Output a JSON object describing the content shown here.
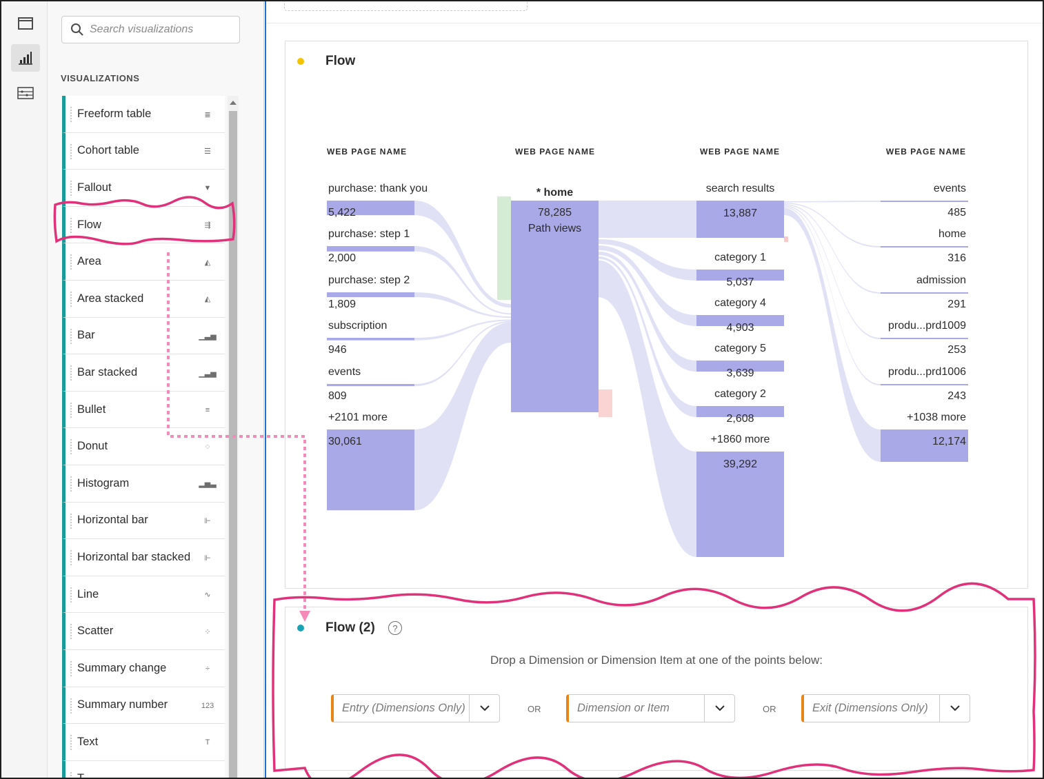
{
  "rail": {
    "items": [
      {
        "name": "panels-icon"
      },
      {
        "name": "visualizations-icon"
      },
      {
        "name": "components-icon"
      }
    ]
  },
  "sidebar": {
    "search_placeholder": "Search visualizations",
    "heading": "VISUALIZATIONS",
    "items": [
      {
        "label": "Freeform table",
        "icon": "≣"
      },
      {
        "label": "Cohort table",
        "icon": "☰"
      },
      {
        "label": "Fallout",
        "icon": "▼"
      },
      {
        "label": "Flow",
        "icon": "⇶"
      },
      {
        "label": "Area",
        "icon": "◭"
      },
      {
        "label": "Area stacked",
        "icon": "◭"
      },
      {
        "label": "Bar",
        "icon": "▁▃▅"
      },
      {
        "label": "Bar stacked",
        "icon": "▁▃▅"
      },
      {
        "label": "Bullet",
        "icon": "≡"
      },
      {
        "label": "Donut",
        "icon": "◌"
      },
      {
        "label": "Histogram",
        "icon": "▂▅▃"
      },
      {
        "label": "Horizontal bar",
        "icon": "⊩"
      },
      {
        "label": "Horizontal bar stacked",
        "icon": "⊩"
      },
      {
        "label": "Line",
        "icon": "∿"
      },
      {
        "label": "Scatter",
        "icon": "⁘"
      },
      {
        "label": "Summary change",
        "icon": "÷"
      },
      {
        "label": "Summary number",
        "icon": "123"
      },
      {
        "label": "Text",
        "icon": "T"
      },
      {
        "label": "T",
        "icon": ""
      }
    ]
  },
  "flow_panel": {
    "title": "Flow",
    "dot_color": "#f5c400",
    "column_header": "WEB PAGE NAME",
    "left_nodes": [
      {
        "label": "purchase: thank you",
        "value": "5,422",
        "size": 5422
      },
      {
        "label": "purchase: step 1",
        "value": "2,000",
        "size": 2000
      },
      {
        "label": "purchase: step 2",
        "value": "1,809",
        "size": 1809
      },
      {
        "label": "subscription",
        "value": "946",
        "size": 946
      },
      {
        "label": "events",
        "value": "809",
        "size": 809
      },
      {
        "label": "+2101 more",
        "value": "30,061",
        "size": 30061
      }
    ],
    "center_node": {
      "label": "* home",
      "value": "78,285",
      "sub": "Path views",
      "size": 78285
    },
    "right_nodes": [
      {
        "label": "search results",
        "value": "13,887",
        "size": 13887
      },
      {
        "label": "category 1",
        "value": "5,037",
        "size": 5037
      },
      {
        "label": "category 4",
        "value": "4,903",
        "size": 4903
      },
      {
        "label": "category 5",
        "value": "3,639",
        "size": 3639
      },
      {
        "label": "category 2",
        "value": "2,608",
        "size": 2608
      },
      {
        "label": "+1860 more",
        "value": "39,292",
        "size": 39292
      }
    ],
    "far_nodes": [
      {
        "label": "events",
        "value": "485",
        "size": 485
      },
      {
        "label": "home",
        "value": "316",
        "size": 316
      },
      {
        "label": "admission",
        "value": "291",
        "size": 291
      },
      {
        "label": "produ...prd1009",
        "value": "253",
        "size": 253
      },
      {
        "label": "produ...prd1006",
        "value": "243",
        "size": 243
      },
      {
        "label": "+1038 more",
        "value": "12,174",
        "size": 12174
      }
    ]
  },
  "flow2_panel": {
    "title": "Flow (2)",
    "dot_color": "#1aa3b5",
    "help": "?",
    "message": "Drop a Dimension or Dimension Item at one of the points below:",
    "entry_placeholder": "Entry (Dimensions Only)",
    "middle_placeholder": "Dimension or Item",
    "exit_placeholder": "Exit (Dimensions Only)",
    "or_label": "OR"
  },
  "colors": {
    "accent_teal": "#1b9a9a",
    "node_fill": "#a9a9e8",
    "link_fill": "#dcdcf5",
    "highlight_pink": "#e0327a",
    "drop_orange": "#e68619"
  }
}
